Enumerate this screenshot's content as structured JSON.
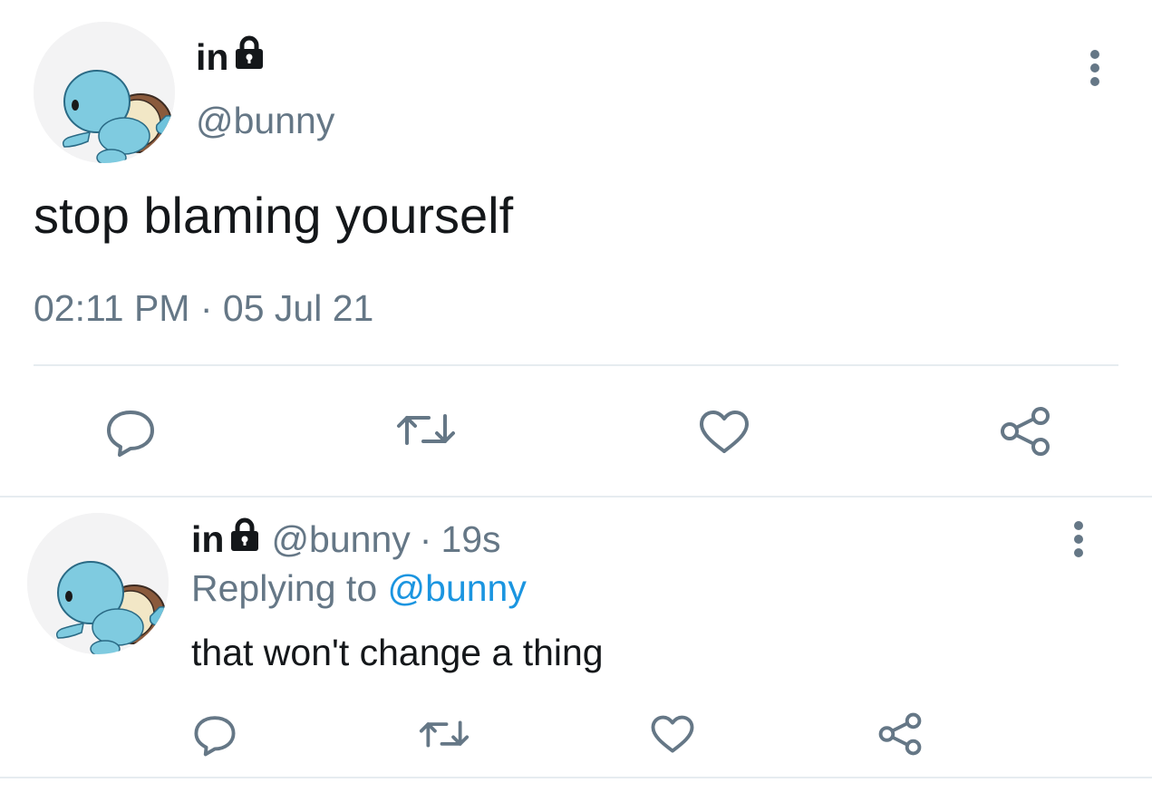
{
  "colors": {
    "text_primary": "#14171a",
    "text_secondary": "#657786",
    "link": "#1b95e0",
    "icon": "#657786",
    "divider": "#e6ecf0"
  },
  "main_tweet": {
    "display_name": "in",
    "protected_icon": "lock-icon",
    "handle": "@bunny",
    "text": "stop blaming yourself",
    "time": "02:11 PM",
    "separator": "·",
    "date": "05 Jul 21",
    "more_icon": "more-vertical-icon",
    "actions": [
      "reply-icon",
      "retweet-icon",
      "like-icon",
      "share-icon"
    ]
  },
  "reply_tweet": {
    "display_name": "in",
    "protected_icon": "lock-icon",
    "handle": "@bunny",
    "separator": "·",
    "age": "19s",
    "replying_prefix": "Replying to",
    "replying_to": "@bunny",
    "text": "that won't change a thing",
    "more_icon": "more-vertical-icon",
    "actions": [
      "reply-icon",
      "retweet-icon",
      "like-icon",
      "share-icon"
    ]
  }
}
